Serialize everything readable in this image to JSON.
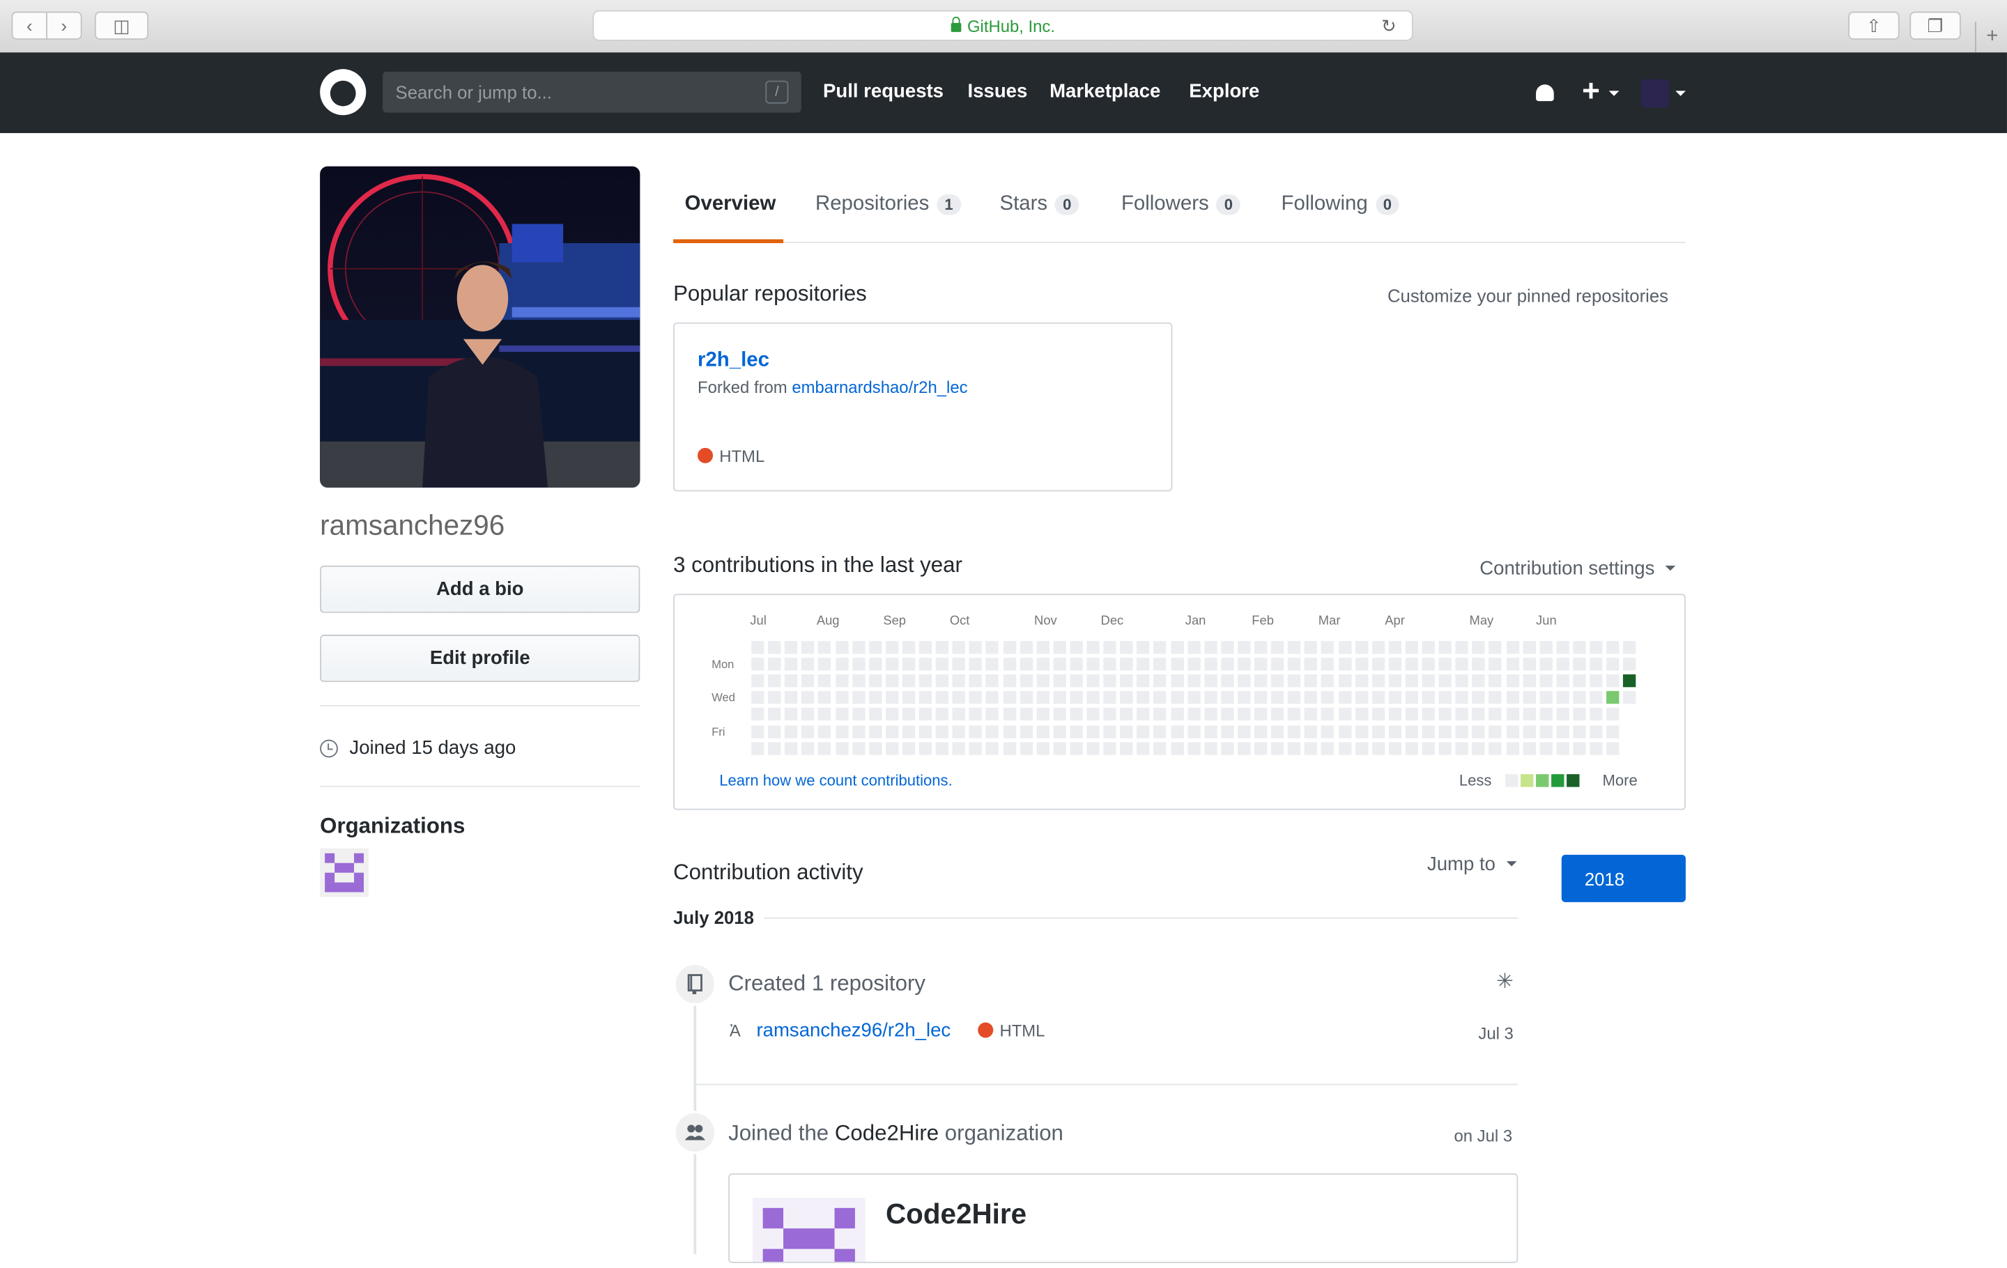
{
  "browser": {
    "address_text": "GitHub, Inc.",
    "icons": [
      "back-icon",
      "forward-icon",
      "sidebar-icon",
      "lock-icon",
      "reload-icon",
      "share-icon",
      "tabs-icon",
      "new-tab-icon"
    ]
  },
  "header": {
    "search_placeholder": "Search or jump to...",
    "search_hint": "/",
    "nav": [
      "Pull requests",
      "Issues",
      "Marketplace",
      "Explore"
    ]
  },
  "profile": {
    "username": "ramsanchez96",
    "add_bio": "Add a bio",
    "edit_profile": "Edit profile",
    "joined": "Joined 15 days ago",
    "organizations_heading": "Organizations"
  },
  "tabs": [
    {
      "label": "Overview",
      "count": null
    },
    {
      "label": "Repositories",
      "count": "1"
    },
    {
      "label": "Stars",
      "count": "0"
    },
    {
      "label": "Followers",
      "count": "0"
    },
    {
      "label": "Following",
      "count": "0"
    }
  ],
  "popular": {
    "heading": "Popular repositories",
    "customize": "Customize your pinned repositories",
    "repo_name": "r2h_lec",
    "forked_prefix": "Forked from ",
    "forked_from": "embarnardshao/r2h_lec",
    "language": "HTML",
    "language_color": "#e34c26"
  },
  "contributions": {
    "heading": "3 contributions in the last year",
    "settings": "Contribution settings",
    "months": [
      "Jul",
      "Aug",
      "Sep",
      "Oct",
      "Nov",
      "Dec",
      "Jan",
      "Feb",
      "Mar",
      "Apr",
      "May",
      "Jun"
    ],
    "days": [
      "Mon",
      "Wed",
      "Fri"
    ],
    "learn": "Learn how we count contributions.",
    "less": "Less",
    "more": "More",
    "colors": [
      "#ebedf0",
      "#c6e48b",
      "#7bc96f",
      "#239a3b",
      "#196127"
    ]
  },
  "activity": {
    "heading": "Contribution activity",
    "jump_to": "Jump to",
    "year": "2018",
    "month": "July 2018",
    "event1_title": "Created 1 repository",
    "event1_repo": "ramsanchez96/r2h_lec",
    "event1_lang": "HTML",
    "event1_date": "Jul 3",
    "event2_prefix": "Joined the ",
    "event2_org": "Code2Hire",
    "event2_suffix": " organization",
    "event2_date": "on Jul 3",
    "org_name": "Code2Hire"
  }
}
